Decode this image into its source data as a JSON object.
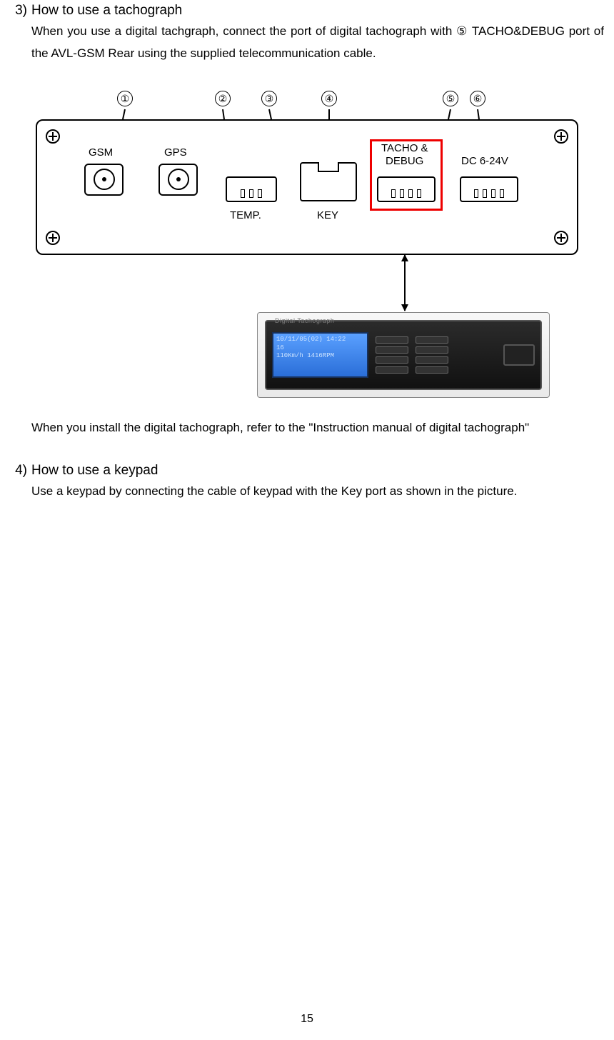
{
  "sections": {
    "s3": {
      "num": "3)",
      "title": "How to use a tachograph",
      "para1": "When you use a digital tachgraph, connect the port of digital tachograph with ⑤ TACHO&DEBUG port of the AVL-GSM Rear using the supplied telecommunication cable.",
      "para2": "When you install the digital tachograph, refer to the \"Instruction manual of digital tachograph\""
    },
    "s4": {
      "num": "4)",
      "title": "How to use a keypad",
      "para1": "Use a keypad by connecting the cable of keypad with the Key port as shown in the picture."
    }
  },
  "diagram": {
    "callouts": {
      "c1": "①",
      "c2": "②",
      "c3": "③",
      "c4": "④",
      "c5": "⑤",
      "c6": "⑥"
    },
    "labels": {
      "gsm": "GSM",
      "gps": "GPS",
      "temp": "TEMP.",
      "key": "KEY",
      "tacho": "TACHO &",
      "debug": "DEBUG",
      "power": "DC 6-24V"
    }
  },
  "tacho_device": {
    "top_label": "Digital Tachograph",
    "lcd_line1": "10/11/05(02) 14:22",
    "lcd_line2": "16",
    "lcd_line3": "110Km/h  1416RPM"
  },
  "page_number": "15"
}
